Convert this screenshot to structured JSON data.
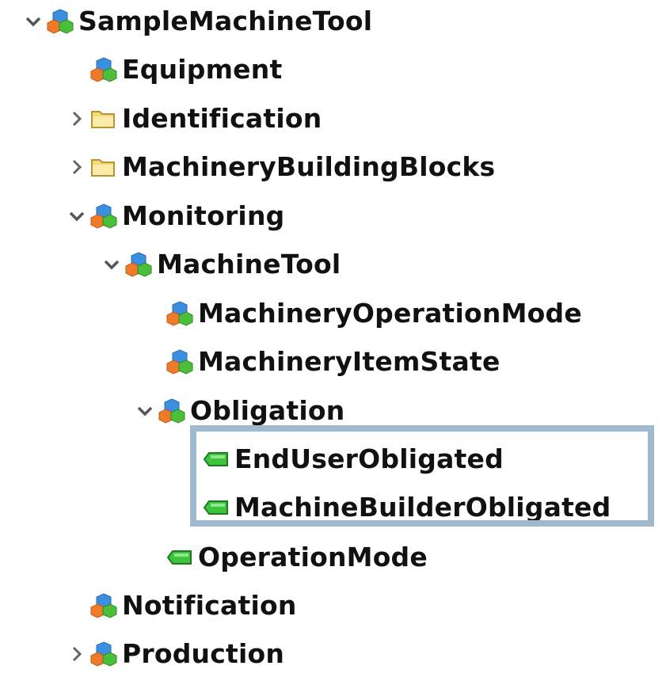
{
  "colors": {
    "highlight_border": "#9fb9cf",
    "text": "#111111",
    "chevron": "#555555",
    "tag_green": "#3fc43f",
    "folder_yellow": "#f2d97a"
  },
  "tree": {
    "nodes": [
      {
        "label": "SampleMachineTool",
        "icon": "object-cubes-icon",
        "expander": "expanded"
      },
      {
        "label": "Equipment",
        "icon": "object-cubes-icon",
        "expander": "none"
      },
      {
        "label": "Identification",
        "icon": "folder-icon",
        "expander": "collapsed"
      },
      {
        "label": "MachineryBuildingBlocks",
        "icon": "folder-icon",
        "expander": "collapsed"
      },
      {
        "label": "Monitoring",
        "icon": "object-cubes-icon",
        "expander": "expanded"
      },
      {
        "label": "MachineTool",
        "icon": "object-cubes-icon",
        "expander": "expanded"
      },
      {
        "label": "MachineryOperationMode",
        "icon": "object-cubes-icon",
        "expander": "none"
      },
      {
        "label": "MachineryItemState",
        "icon": "object-cubes-icon",
        "expander": "none"
      },
      {
        "label": "Obligation",
        "icon": "object-cubes-icon",
        "expander": "expanded"
      },
      {
        "label": "EndUserObligated",
        "icon": "variable-tag-icon",
        "expander": "none"
      },
      {
        "label": "MachineBuilderObligated",
        "icon": "variable-tag-icon",
        "expander": "none"
      },
      {
        "label": "OperationMode",
        "icon": "variable-tag-icon",
        "expander": "none"
      },
      {
        "label": "Notification",
        "icon": "object-cubes-icon",
        "expander": "none"
      },
      {
        "label": "Production",
        "icon": "object-cubes-icon",
        "expander": "collapsed"
      }
    ]
  }
}
